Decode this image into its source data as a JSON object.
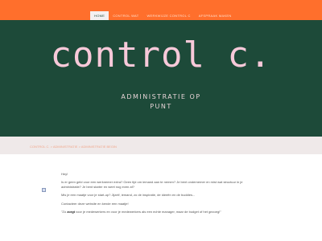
{
  "nav": {
    "items": [
      {
        "label": "HOME",
        "active": true
      },
      {
        "label": "CONTROL WAT"
      },
      {
        "label": "WERKWIJZE CONTROL C"
      },
      {
        "label": "AFSPRAAK MAKEN"
      }
    ]
  },
  "hero": {
    "logo": "control c.",
    "tagline_line1": "ADMINISTRATIE OP",
    "tagline_line2": "PUNT"
  },
  "breadcrumb": "CONTROL C. > ADMINISTRATIE > ADMINISTRATIE BEGIN",
  "content": {
    "greeting": "Hey!",
    "paragraph1_line1": "Is er geen geld voor een werknemer extra? Geen tijd om iemand aan te nemen? Je bent ondernemer en mist wat structuur in je",
    "paragraph1_line2": "administratie? Je bent starter en weet nog even af?",
    "paragraph2": "Mis je een maatje voor je start-up? Jijzelf, iemand, zo de inspiratie, de ideeën en de buddies...",
    "paragraph3": "Contacteer deze website en kende een maatje!",
    "quote_prefix": "\"Zo ",
    "quote_bold": "zorgt",
    "quote_rest": " voor je medewerkers en voor je medewerkers als een echte manager, maar de budget of het gezoeg!\""
  },
  "colors": {
    "accent_orange": "#ff6f2c",
    "hero_green": "#1d4a39",
    "logo_pink": "#f7c9d9"
  }
}
